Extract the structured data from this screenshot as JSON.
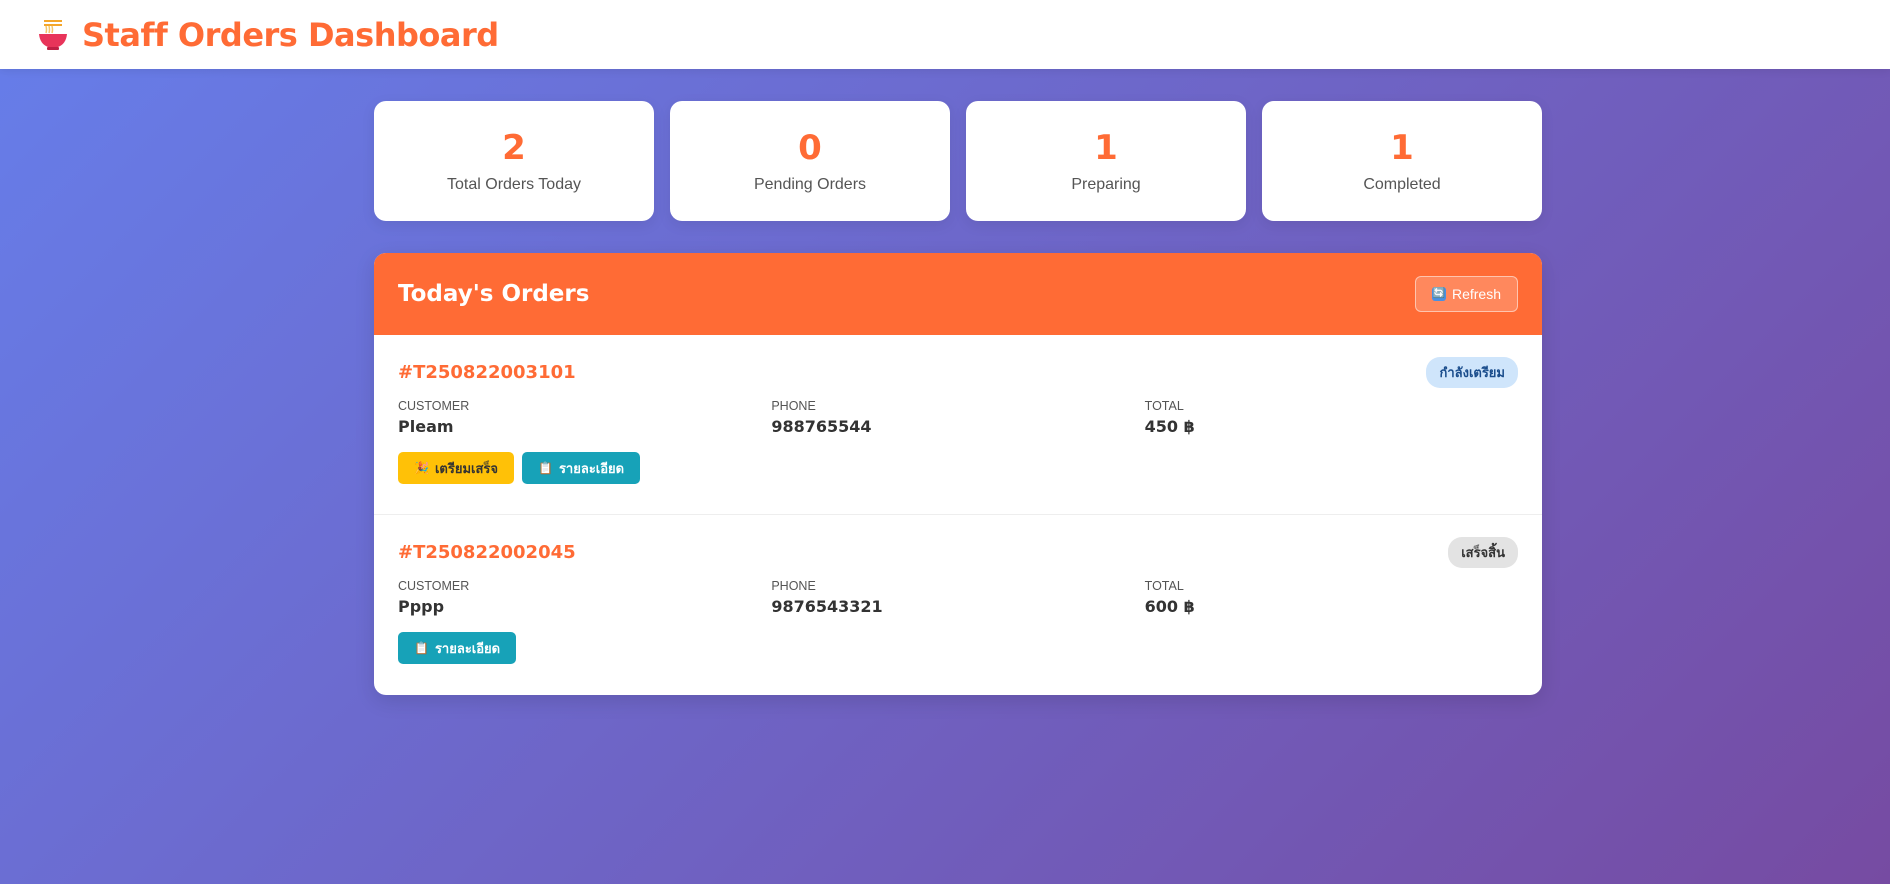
{
  "app": {
    "title": "Staff Orders Dashboard",
    "logo_icon": "noodle-bowl-icon"
  },
  "stats": [
    {
      "value": "2",
      "label": "Total Orders Today"
    },
    {
      "value": "0",
      "label": "Pending Orders"
    },
    {
      "value": "1",
      "label": "Preparing"
    },
    {
      "value": "1",
      "label": "Completed"
    }
  ],
  "orders_panel": {
    "title": "Today's Orders",
    "refresh_icon": "🔄",
    "refresh_label": "Refresh"
  },
  "field_labels": {
    "customer": "CUSTOMER",
    "phone": "PHONE",
    "total": "TOTAL"
  },
  "orders": [
    {
      "id": "#T250822003101",
      "status": "กำลังเตรียม",
      "customer": "Pleam",
      "phone": "988765544",
      "total": "450 ฿",
      "ready_icon": "🎉",
      "ready_label": "เตรียมเสร็จ",
      "detail_icon": "📋",
      "detail_label": "รายละเอียด"
    },
    {
      "id": "#T250822002045",
      "status": "เสร็จสิ้น",
      "customer": "Pppp",
      "phone": "9876543321",
      "total": "600 ฿",
      "detail_icon": "📋",
      "detail_label": "รายละเอียด"
    }
  ],
  "colors": {
    "accent": "#ff6b35",
    "ready": "#ffc107",
    "detail": "#17a2b8"
  }
}
